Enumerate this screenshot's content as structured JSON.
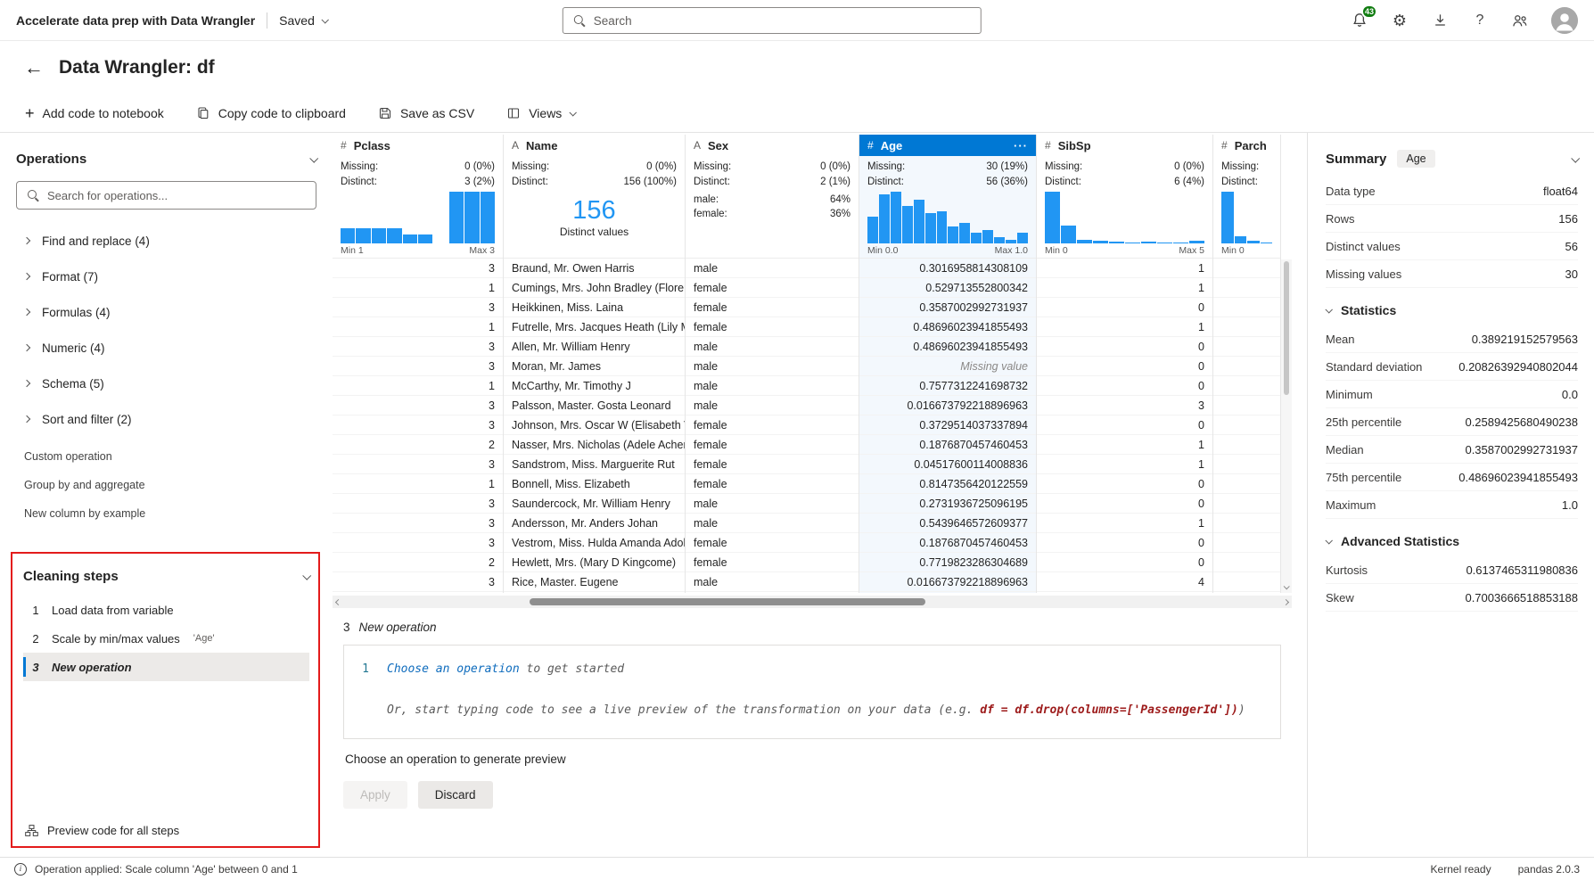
{
  "colors": {
    "accent": "#0078d4",
    "histogram": "#2196f3",
    "annotation_box": "#e31b1b",
    "badge_green": "#107c10"
  },
  "topbar": {
    "app_title": "Accelerate data prep with Data Wrangler",
    "saved_label": "Saved",
    "search_placeholder": "Search",
    "notification_count": "43"
  },
  "header": {
    "title": "Data Wrangler: df"
  },
  "toolbar": {
    "add_code": "Add code to notebook",
    "copy_code": "Copy code to clipboard",
    "save_csv": "Save as CSV",
    "views": "Views"
  },
  "operations": {
    "title": "Operations",
    "search_placeholder": "Search for operations...",
    "groups": [
      "Find and replace (4)",
      "Format (7)",
      "Formulas (4)",
      "Numeric (4)",
      "Schema (5)",
      "Sort and filter (2)"
    ],
    "items": [
      "Custom operation",
      "Group by and aggregate",
      "New column by example"
    ]
  },
  "cleaning_steps": {
    "title": "Cleaning steps",
    "steps": [
      {
        "num": "1",
        "label": "Load data from variable",
        "note": "",
        "active": false
      },
      {
        "num": "2",
        "label": "Scale by min/max values",
        "note": "'Age'",
        "active": false
      },
      {
        "num": "3",
        "label": "New operation",
        "note": "",
        "active": true
      }
    ],
    "footer": "Preview code for all steps"
  },
  "grid": {
    "columns": [
      {
        "name": "Pclass",
        "type": "numeric",
        "missing": "0 (0%)",
        "distinct": "3 (2%)",
        "viz": "hist",
        "bars": [
          0.29,
          0.29,
          0.29,
          0.29,
          0.17,
          0.17,
          0,
          1,
          1,
          1
        ],
        "min": "Min 1",
        "max": "Max 3",
        "selected": false
      },
      {
        "name": "Name",
        "type": "text",
        "missing": "0 (0%)",
        "distinct": "156 (100%)",
        "viz": "distinct",
        "big": "156",
        "big_label": "Distinct values",
        "selected": false
      },
      {
        "name": "Sex",
        "type": "text",
        "missing": "0 (0%)",
        "distinct": "2 (1%)",
        "viz": "cats",
        "cats": [
          {
            "label": "male:",
            "value": "64%"
          },
          {
            "label": "female:",
            "value": "36%"
          }
        ],
        "selected": false
      },
      {
        "name": "Age",
        "type": "numeric",
        "missing": "30 (19%)",
        "distinct": "56 (36%)",
        "viz": "hist",
        "bars": [
          0.52,
          0.95,
          1,
          0.72,
          0.85,
          0.58,
          0.62,
          0.32,
          0.4,
          0.2,
          0.26,
          0.12,
          0.07,
          0.2
        ],
        "min": "Min 0.0",
        "max": "Max 1.0",
        "selected": true,
        "menu": "···"
      },
      {
        "name": "SibSp",
        "type": "numeric",
        "missing": "0 (0%)",
        "distinct": "6 (4%)",
        "viz": "hist",
        "bars": [
          1,
          0.34,
          0.07,
          0.05,
          0.03,
          0.02,
          0.04,
          0.02,
          0.01,
          0.06
        ],
        "min": "Min 0",
        "max": "Max 5",
        "selected": false
      },
      {
        "name": "Parch",
        "type": "numeric",
        "missing": "",
        "distinct": "",
        "viz": "hist",
        "bars": [
          1,
          0.13,
          0.05,
          0.02
        ],
        "min": "Min 0",
        "max": "",
        "selected": false
      }
    ],
    "rows": [
      [
        "3",
        "Braund, Mr. Owen Harris",
        "male",
        "0.3016958814308109",
        "1",
        ""
      ],
      [
        "1",
        "Cumings, Mrs. John Bradley (Florenc",
        "female",
        "0.529713552800342",
        "1",
        ""
      ],
      [
        "3",
        "Heikkinen, Miss. Laina",
        "female",
        "0.3587002992731937",
        "0",
        ""
      ],
      [
        "1",
        "Futrelle, Mrs. Jacques Heath (Lily Ma",
        "female",
        "0.48696023941855493",
        "1",
        ""
      ],
      [
        "3",
        "Allen, Mr. William Henry",
        "male",
        "0.48696023941855493",
        "0",
        ""
      ],
      [
        "3",
        "Moran, Mr. James",
        "male",
        "Missing value",
        "0",
        ""
      ],
      [
        "1",
        "McCarthy, Mr. Timothy J",
        "male",
        "0.7577312241698732",
        "0",
        ""
      ],
      [
        "3",
        "Palsson, Master. Gosta Leonard",
        "male",
        "0.016673792218896963",
        "3",
        ""
      ],
      [
        "3",
        "Johnson, Mrs. Oscar W (Elisabeth Vil",
        "female",
        "0.3729514037337894",
        "0",
        ""
      ],
      [
        "2",
        "Nasser, Mrs. Nicholas (Adele Achem",
        "female",
        "0.1876870457460453",
        "1",
        ""
      ],
      [
        "3",
        "Sandstrom, Miss. Marguerite Rut",
        "female",
        "0.04517600114008836",
        "1",
        ""
      ],
      [
        "1",
        "Bonnell, Miss. Elizabeth",
        "female",
        "0.8147356420122559",
        "0",
        ""
      ],
      [
        "3",
        "Saundercock, Mr. William Henry",
        "male",
        "0.2731936725096195",
        "0",
        ""
      ],
      [
        "3",
        "Andersson, Mr. Anders Johan",
        "male",
        "0.5439646572609377",
        "1",
        ""
      ],
      [
        "3",
        "Vestrom, Miss. Hulda Amanda Adolf",
        "female",
        "0.1876870457460453",
        "0",
        ""
      ],
      [
        "2",
        "Hewlett, Mrs. (Mary D Kingcome)",
        "female",
        "0.7719823286304689",
        "0",
        ""
      ],
      [
        "3",
        "Rice, Master. Eugene",
        "male",
        "0.016673792218896963",
        "4",
        ""
      ]
    ]
  },
  "code_panel": {
    "step_label": "3",
    "step_name": "New operation",
    "line_number": "1",
    "line1_link": "Choose an operation",
    "line1_rest": " to get started",
    "line2_prefix": "Or, start typing code to see a live preview of the transformation on your data (e.g. ",
    "line2_code": "df = df.drop(columns=['PassengerId'])",
    "line2_suffix": ")",
    "hint": "Choose an operation to generate preview",
    "apply": "Apply",
    "discard": "Discard"
  },
  "summary": {
    "title": "Summary",
    "column_chip": "Age",
    "info": [
      [
        "Data type",
        "float64"
      ],
      [
        "Rows",
        "156"
      ],
      [
        "Distinct values",
        "56"
      ],
      [
        "Missing values",
        "30"
      ]
    ],
    "statistics_title": "Statistics",
    "statistics": [
      [
        "Mean",
        "0.389219152579563"
      ],
      [
        "Standard deviation",
        "0.20826392940802044"
      ],
      [
        "Minimum",
        "0.0"
      ],
      [
        "25th percentile",
        "0.2589425680490238"
      ],
      [
        "Median",
        "0.3587002992731937"
      ],
      [
        "75th percentile",
        "0.48696023941855493"
      ],
      [
        "Maximum",
        "1.0"
      ]
    ],
    "advanced_title": "Advanced Statistics",
    "advanced": [
      [
        "Kurtosis",
        "0.6137465311980836"
      ],
      [
        "Skew",
        "0.7003666518853188"
      ]
    ]
  },
  "statusbar": {
    "message": "Operation applied: Scale column 'Age' between 0 and 1",
    "kernel": "Kernel ready",
    "pandas": "pandas 2.0.3"
  }
}
